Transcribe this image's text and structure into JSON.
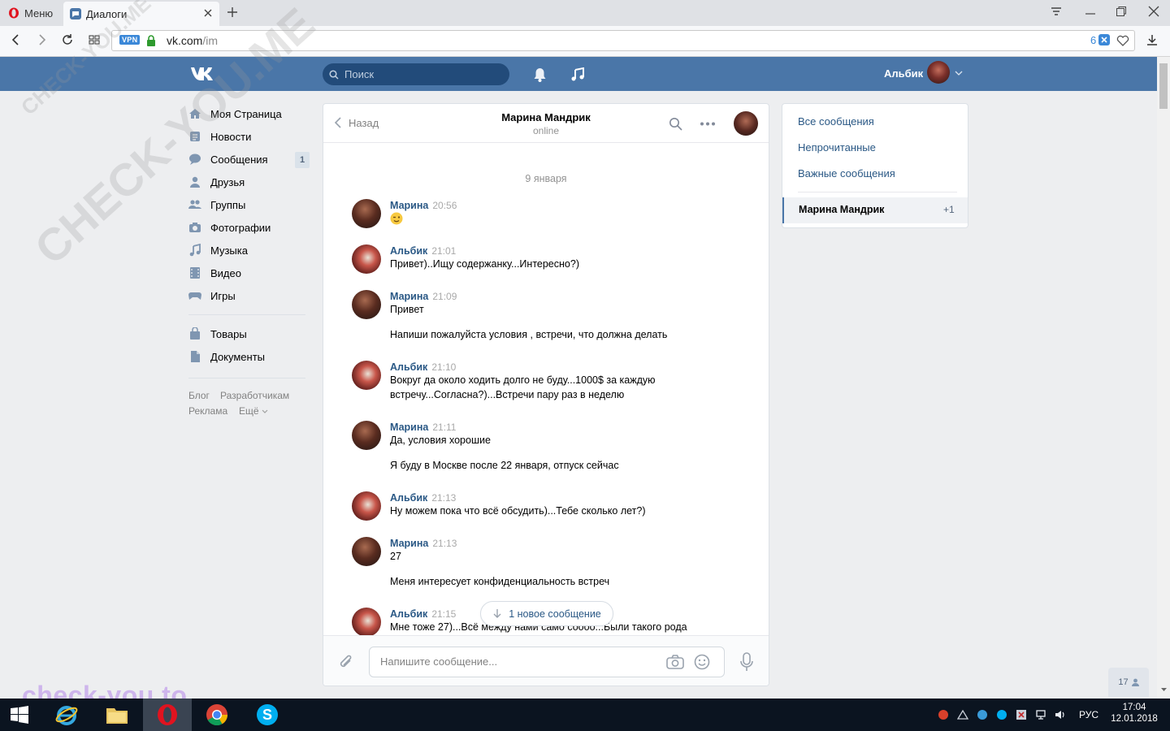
{
  "browser": {
    "menu_label": "Меню",
    "tab_title": "Диалоги",
    "url_host": "vk.com",
    "url_path": "/im",
    "vpn_label": "VPN",
    "url_badge": "6"
  },
  "header": {
    "logo": "VK",
    "search_placeholder": "Поиск",
    "user_name": "Альбик"
  },
  "sidebar": {
    "items": [
      {
        "label": "Моя Страница",
        "icon": "home-icon"
      },
      {
        "label": "Новости",
        "icon": "news-icon"
      },
      {
        "label": "Сообщения",
        "icon": "messages-icon",
        "badge": "1"
      },
      {
        "label": "Друзья",
        "icon": "friends-icon"
      },
      {
        "label": "Группы",
        "icon": "groups-icon"
      },
      {
        "label": "Фотографии",
        "icon": "camera-icon"
      },
      {
        "label": "Музыка",
        "icon": "music-icon"
      },
      {
        "label": "Видео",
        "icon": "video-icon"
      },
      {
        "label": "Игры",
        "icon": "games-icon"
      }
    ],
    "items2": [
      {
        "label": "Товары",
        "icon": "market-icon"
      },
      {
        "label": "Документы",
        "icon": "documents-icon"
      }
    ],
    "footer": {
      "blog": "Блог",
      "dev": "Разработчикам",
      "ads": "Реклама",
      "more": "Ещё"
    }
  },
  "chat": {
    "back_label": "Назад",
    "contact_name": "Марина Мандрик",
    "contact_status": "online",
    "date_divider": "9 января",
    "messages": [
      {
        "author": "Марина",
        "time": "20:56",
        "lines": []
      },
      {
        "author": "Альбик",
        "time": "21:01",
        "lines": [
          "Привет)..Ищу содержанку...Интересно?)"
        ]
      },
      {
        "author": "Марина",
        "time": "21:09",
        "lines": [
          "Привет",
          "Напиши пожалуйста условия , встречи, что должна делать"
        ]
      },
      {
        "author": "Альбик",
        "time": "21:10",
        "lines": [
          "Вокруг да около ходить долго не буду...1000$ за каждую встречу...Согласна?)...Встречи пару раз в неделю"
        ]
      },
      {
        "author": "Марина",
        "time": "21:11",
        "lines": [
          "Да, условия хорошие",
          "Я буду в Москве после 22 января, отпуск сейчас"
        ]
      },
      {
        "author": "Альбик",
        "time": "21:13",
        "lines": [
          "Ну можем пока что всё обсудить)...Тебе сколько лет?)"
        ]
      },
      {
        "author": "Марина",
        "time": "21:13",
        "lines": [
          "27",
          "Меня интересует конфиденциальность встреч"
        ]
      },
      {
        "author": "Альбик",
        "time": "21:15",
        "lines": [
          "Мне тоже 27)...Всё между нами само соооо...Были такого рода"
        ]
      }
    ],
    "new_message_pill": "1 новое сообщение",
    "compose_placeholder": "Напишите сообщение..."
  },
  "right_panel": {
    "items": [
      "Все сообщения",
      "Непрочитанные",
      "Важные сообщения"
    ],
    "selected": {
      "name": "Марина Мандрик",
      "count": "+1"
    }
  },
  "online_friends_count": "17",
  "watermark": {
    "text": "check-you.to",
    "diag": "CHECK-YOU.ME"
  },
  "taskbar": {
    "lang": "РУС",
    "time": "17:04",
    "date": "12.01.2018"
  },
  "colors": {
    "vk_header": "#4a76a8",
    "link": "#2a5885",
    "taskbar": "#0b1420"
  }
}
